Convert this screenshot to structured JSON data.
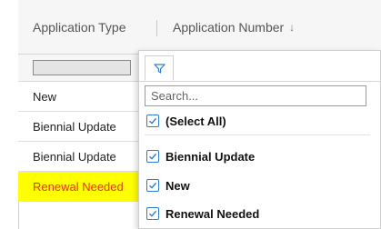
{
  "grid": {
    "columns": [
      {
        "label": "Application Type"
      },
      {
        "label": "Application Number",
        "sort_icon": "sort-descending-icon",
        "sort_glyph": "↓"
      }
    ],
    "rows": [
      {
        "type": "New",
        "highlighted": false
      },
      {
        "type": "Biennial Update",
        "highlighted": false
      },
      {
        "type": "Biennial Update",
        "highlighted": false
      },
      {
        "type": "Renewal Needed",
        "highlighted": true
      }
    ],
    "highlight_background": "#ffff00",
    "highlight_text_color": "#e8301c"
  },
  "filter_popup": {
    "tab_icon": "filter-icon",
    "search_placeholder": "Search...",
    "options": [
      {
        "label": "(Select All)",
        "checked": true
      },
      {
        "label": "Biennial Update",
        "checked": true
      },
      {
        "label": "New",
        "checked": true
      },
      {
        "label": "Renewal Needed",
        "checked": true
      }
    ],
    "accent_color": "#2f7fd1"
  }
}
